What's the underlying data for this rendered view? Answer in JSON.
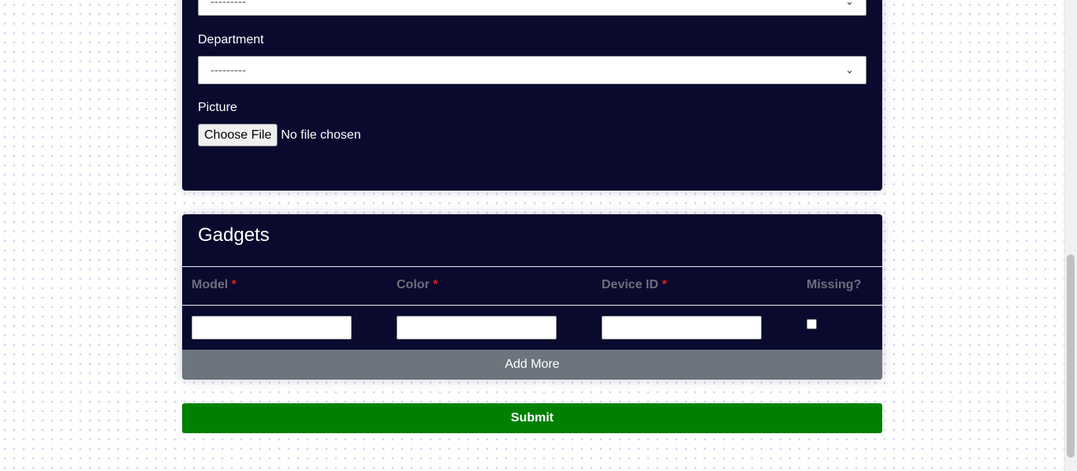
{
  "form": {
    "prev_select": {
      "value": "---------"
    },
    "department": {
      "label": "Department",
      "value": "---------"
    },
    "picture": {
      "label": "Picture",
      "button": "Choose File",
      "status": "No file chosen"
    }
  },
  "gadgets": {
    "title": "Gadgets",
    "columns": [
      {
        "label": "Model",
        "required": "*"
      },
      {
        "label": "Color",
        "required": "*"
      },
      {
        "label": "Device ID",
        "required": "*"
      },
      {
        "label": "Missing?"
      }
    ],
    "add_more": "Add More"
  },
  "submit": "Submit",
  "colors": {
    "card_bg": "#0a0a2e",
    "submit": "#008000",
    "add_more": "#6c757d",
    "required": "#dd2222"
  }
}
